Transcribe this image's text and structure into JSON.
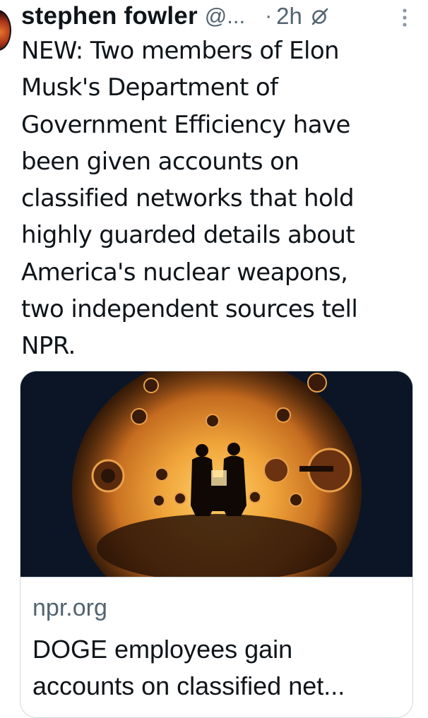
{
  "tweet": {
    "author_name": "stephen fowler",
    "handle": "@...",
    "separator": "·",
    "time": "2h",
    "text": "NEW: Two members of Elon\nMusk's Department of\nGovernment Efficiency have\nbeen given accounts on\nclassified networks that hold\nhighly guarded details about\nAmerica's nuclear weapons,\ntwo independent sources tell\nNPR.",
    "icons": {
      "grok": "grok-icon",
      "more": "more-options-icon"
    }
  },
  "link_card": {
    "domain": "npr.org",
    "title": "DOGE employees gain\naccounts on classified net..."
  }
}
